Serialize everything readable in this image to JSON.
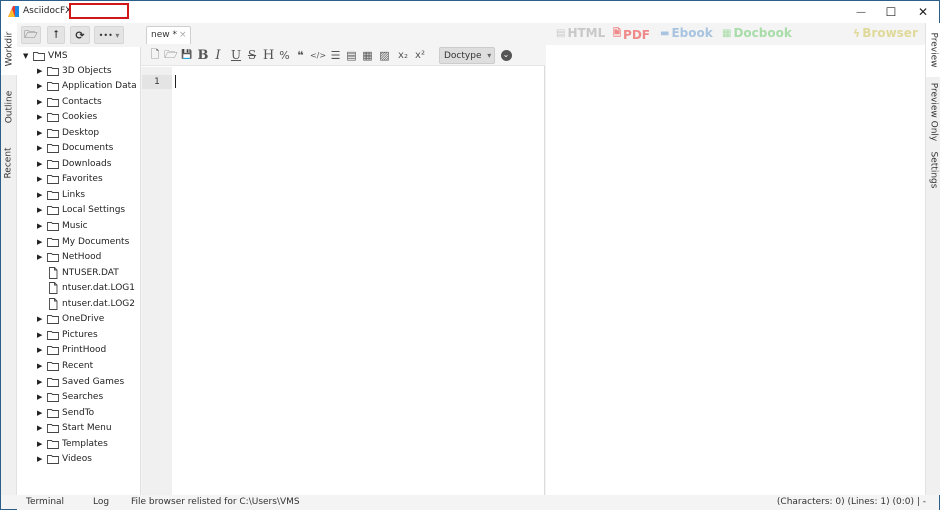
{
  "window": {
    "title": "AsciidocFX -",
    "controls": {
      "minimize": "—",
      "maximize": "☐",
      "close": "✕"
    }
  },
  "left_tabs": [
    {
      "label": "Workdir",
      "active": true
    },
    {
      "label": "Outline",
      "active": false
    },
    {
      "label": "Recent",
      "active": false
    }
  ],
  "right_tabs": [
    {
      "label": "Preview",
      "active": true
    },
    {
      "label": "Preview Only",
      "active": false
    },
    {
      "label": "Settings",
      "active": false
    }
  ],
  "file_browser": {
    "toolbar": {
      "open_icon": "🗁",
      "up_icon": "⭡",
      "refresh_icon": "⟳",
      "more_label": "•••",
      "more_caret": "▾"
    },
    "root": {
      "label": "VMS",
      "expanded": true,
      "toggle": "▼"
    },
    "items": [
      {
        "label": "3D Objects",
        "type": "folder"
      },
      {
        "label": "Application Data",
        "type": "folder"
      },
      {
        "label": "Contacts",
        "type": "folder"
      },
      {
        "label": "Cookies",
        "type": "folder"
      },
      {
        "label": "Desktop",
        "type": "folder"
      },
      {
        "label": "Documents",
        "type": "folder"
      },
      {
        "label": "Downloads",
        "type": "folder"
      },
      {
        "label": "Favorites",
        "type": "folder"
      },
      {
        "label": "Links",
        "type": "folder"
      },
      {
        "label": "Local Settings",
        "type": "folder"
      },
      {
        "label": "Music",
        "type": "folder"
      },
      {
        "label": "My Documents",
        "type": "folder"
      },
      {
        "label": "NetHood",
        "type": "folder"
      },
      {
        "label": "NTUSER.DAT",
        "type": "file"
      },
      {
        "label": "ntuser.dat.LOG1",
        "type": "file"
      },
      {
        "label": "ntuser.dat.LOG2",
        "type": "file"
      },
      {
        "label": "OneDrive",
        "type": "folder"
      },
      {
        "label": "Pictures",
        "type": "folder"
      },
      {
        "label": "PrintHood",
        "type": "folder"
      },
      {
        "label": "Recent",
        "type": "folder"
      },
      {
        "label": "Saved Games",
        "type": "folder"
      },
      {
        "label": "Searches",
        "type": "folder"
      },
      {
        "label": "SendTo",
        "type": "folder"
      },
      {
        "label": "Start Menu",
        "type": "folder"
      },
      {
        "label": "Templates",
        "type": "folder"
      },
      {
        "label": "Videos",
        "type": "folder"
      }
    ]
  },
  "editor": {
    "tab": {
      "label": "new *",
      "close": "×"
    },
    "toolbar": {
      "new_file": "🗋",
      "open": "🗁",
      "save": "💾",
      "bold": "B",
      "italic": "I",
      "underline": "U",
      "strike": "S",
      "header": "H",
      "link": "%",
      "quote": "❝",
      "code": "</>",
      "ul": "☰",
      "block": "▤",
      "table": "▦",
      "image": "▨",
      "subscript": "x₂",
      "superscript": "x²",
      "doctype_label": "Doctype",
      "doctype_caret": "▾",
      "more": "⌄"
    },
    "line_numbers": [
      "1"
    ],
    "content": ""
  },
  "preview": {
    "links": [
      {
        "label": "HTML",
        "icon": "▤",
        "color": "#c8c8c8"
      },
      {
        "label": "PDF",
        "icon": "🗎",
        "color": "#f08a8a"
      },
      {
        "label": "Ebook",
        "icon": "▬",
        "color": "#a8c4e0"
      },
      {
        "label": "Docbook",
        "icon": "▦",
        "color": "#a8dca8"
      },
      {
        "label": "Browser",
        "icon": "ϟ",
        "color": "#e0da9a"
      }
    ]
  },
  "statusbar": {
    "terminal": "Terminal",
    "log": "Log",
    "message": "File browser relisted for C:\\Users\\VMS",
    "stats": "(Characters: 0) (Lines: 1) (0:0) | -"
  }
}
